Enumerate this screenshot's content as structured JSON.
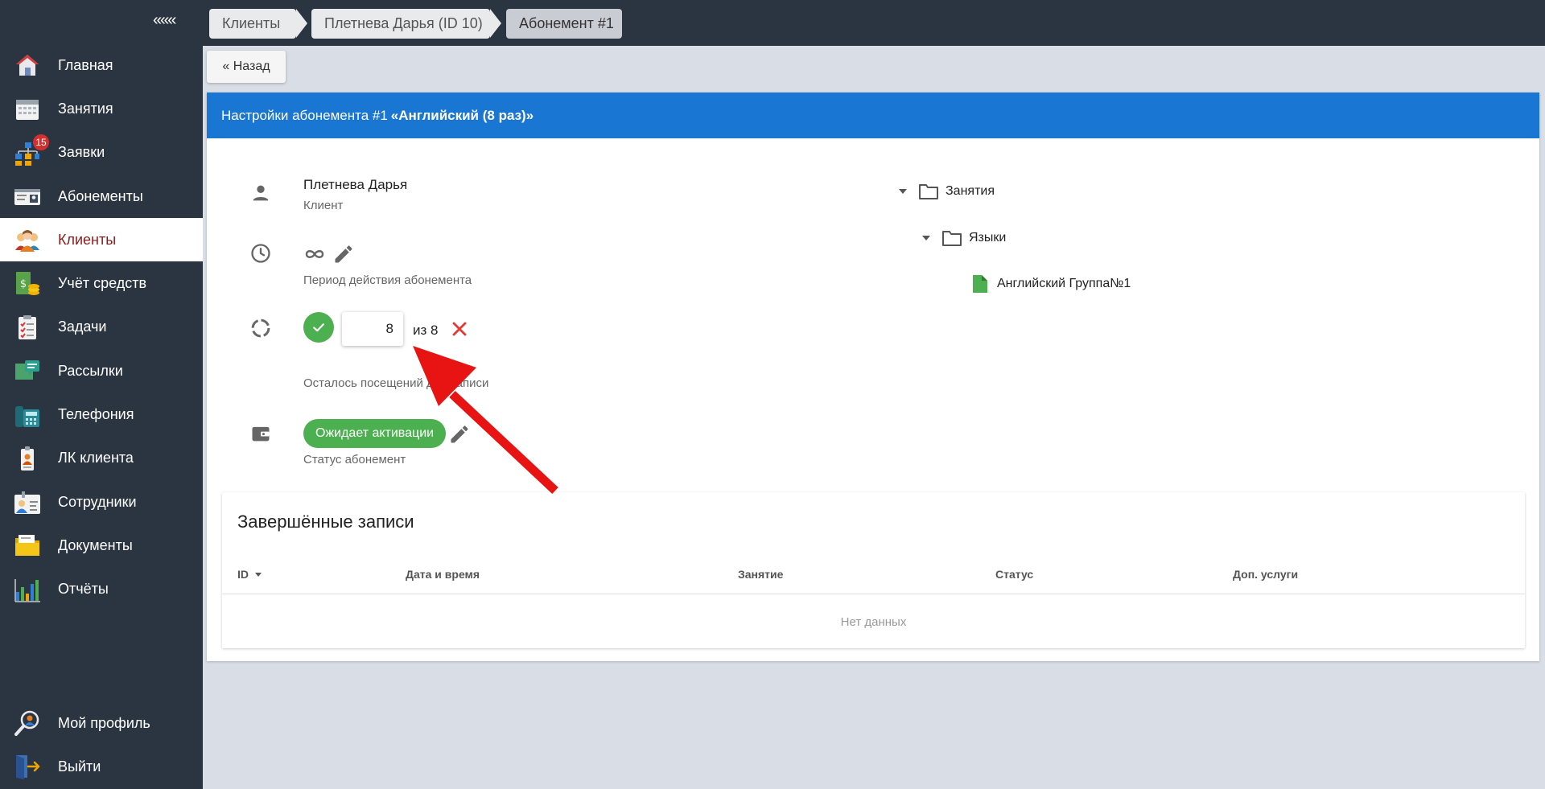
{
  "sidebar": {
    "collapse_label": "«««",
    "items": [
      {
        "label": "Главная",
        "icon": "home-icon"
      },
      {
        "label": "Занятия",
        "icon": "calendar-icon"
      },
      {
        "label": "Заявки",
        "icon": "requests-icon",
        "badge": "15"
      },
      {
        "label": "Абонементы",
        "icon": "subscriptions-icon"
      },
      {
        "label": "Клиенты",
        "icon": "clients-icon",
        "active": true
      },
      {
        "label": "Учёт средств",
        "icon": "money-icon"
      },
      {
        "label": "Задачи",
        "icon": "tasks-icon"
      },
      {
        "label": "Рассылки",
        "icon": "mailing-icon"
      },
      {
        "label": "Телефония",
        "icon": "phone-icon"
      },
      {
        "label": "ЛК клиента",
        "icon": "client-cabinet-icon"
      },
      {
        "label": "Сотрудники",
        "icon": "staff-icon"
      },
      {
        "label": "Документы",
        "icon": "documents-icon"
      },
      {
        "label": "Отчёты",
        "icon": "reports-icon"
      }
    ],
    "bottom_items": [
      {
        "label": "Мой профиль",
        "icon": "profile-icon"
      },
      {
        "label": "Выйти",
        "icon": "logout-icon"
      }
    ]
  },
  "breadcrumbs": [
    "Клиенты",
    "Плетнева Дарья (ID 10)",
    "Абонемент #1"
  ],
  "back_label": "« Назад",
  "card": {
    "title_prefix": "Настройки абонемента #1",
    "title_name": "«Английский (8 раз)»",
    "client_name": "Плетнева Дарья",
    "client_caption": "Клиент",
    "period_caption": "Период действия абонемента",
    "visits_value": "8",
    "visits_of": "из 8",
    "visits_caption": "Осталось посещений для записи",
    "status_label": "Ожидает активации",
    "status_caption": "Статус абонемент"
  },
  "tree": [
    {
      "label": "Занятия",
      "type": "folder",
      "level": 0
    },
    {
      "label": "Языки",
      "type": "folder",
      "level": 1
    },
    {
      "label": "Английский Группа№1",
      "type": "file",
      "level": 2
    }
  ],
  "completed": {
    "title": "Завершённые записи",
    "columns": [
      "ID",
      "Дата и время",
      "Занятие",
      "Статус",
      "Доп. услуги"
    ],
    "empty_text": "Нет данных"
  },
  "colors": {
    "sidebar_bg": "#2b3542",
    "header_blue": "#1976d2",
    "green": "#4caf50",
    "active_text": "#8b1a1a",
    "annotation_red": "#e81414"
  }
}
